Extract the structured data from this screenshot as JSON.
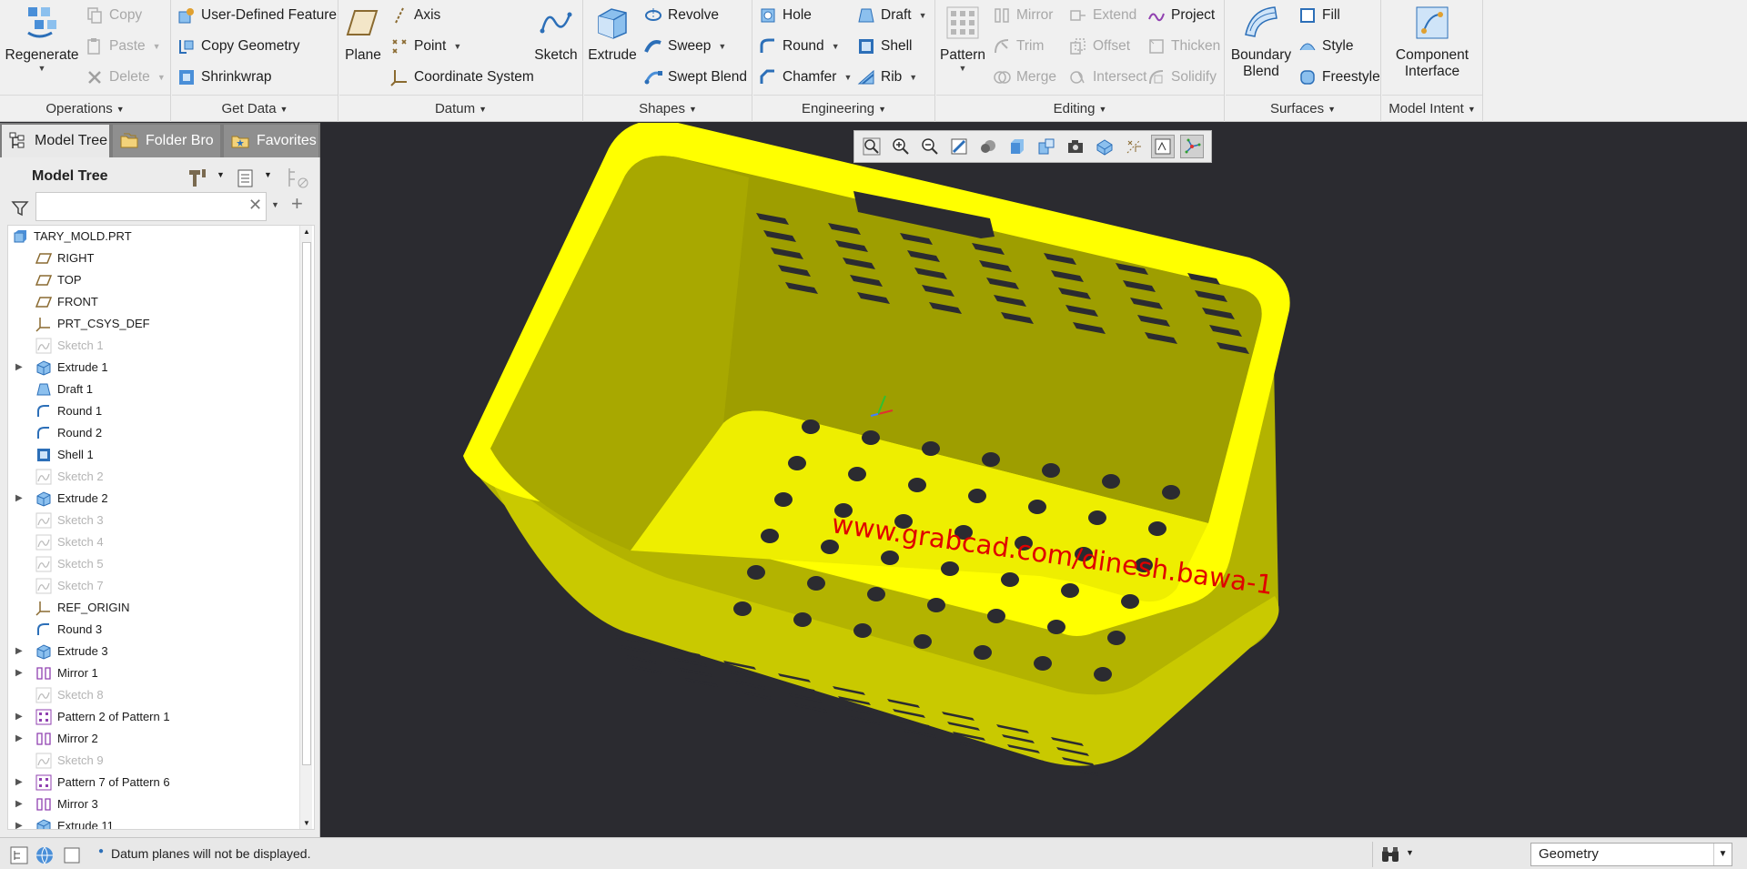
{
  "ribbon": {
    "operations": {
      "regenerate": "Regenerate",
      "copy": "Copy",
      "paste": "Paste",
      "delete": "Delete",
      "label": "Operations"
    },
    "get_data": {
      "user_defined_feature": "User-Defined Feature",
      "copy_geometry": "Copy Geometry",
      "shrinkwrap": "Shrinkwrap",
      "label": "Get Data"
    },
    "datum": {
      "plane": "Plane",
      "axis": "Axis",
      "point": "Point",
      "coordinate_system": "Coordinate System",
      "sketch": "Sketch",
      "label": "Datum"
    },
    "shapes": {
      "extrude": "Extrude",
      "revolve": "Revolve",
      "sweep": "Sweep",
      "swept_blend": "Swept Blend",
      "label": "Shapes"
    },
    "engineering": {
      "hole": "Hole",
      "round": "Round",
      "chamfer": "Chamfer",
      "draft": "Draft",
      "shell": "Shell",
      "rib": "Rib",
      "label": "Engineering"
    },
    "editing": {
      "pattern": "Pattern",
      "mirror": "Mirror",
      "trim": "Trim",
      "merge": "Merge",
      "extend": "Extend",
      "offset": "Offset",
      "intersect": "Intersect",
      "project": "Project",
      "thicken": "Thicken",
      "solidify": "Solidify",
      "label": "Editing"
    },
    "surfaces": {
      "boundary_blend_1": "Boundary",
      "boundary_blend_2": "Blend",
      "fill": "Fill",
      "style": "Style",
      "freestyle": "Freestyle",
      "label": "Surfaces"
    },
    "model_intent": {
      "component_interface_1": "Component",
      "component_interface_2": "Interface",
      "label": "Model Intent"
    }
  },
  "panel": {
    "tabs": [
      "Model Tree",
      "Folder Bro",
      "Favorites"
    ],
    "title": "Model Tree",
    "search_value": "",
    "tree": [
      {
        "label": "TARY_MOLD.PRT",
        "icon": "part-icon",
        "expandable": false,
        "dim": false
      },
      {
        "label": "RIGHT",
        "icon": "datum-plane-icon",
        "expandable": false,
        "dim": false
      },
      {
        "label": "TOP",
        "icon": "datum-plane-icon",
        "expandable": false,
        "dim": false
      },
      {
        "label": "FRONT",
        "icon": "datum-plane-icon",
        "expandable": false,
        "dim": false
      },
      {
        "label": "PRT_CSYS_DEF",
        "icon": "csys-icon",
        "expandable": false,
        "dim": false
      },
      {
        "label": "Sketch 1",
        "icon": "sketch-icon",
        "expandable": false,
        "dim": true
      },
      {
        "label": "Extrude 1",
        "icon": "extrude-icon",
        "expandable": true,
        "dim": false
      },
      {
        "label": "Draft 1",
        "icon": "draft-icon",
        "expandable": false,
        "dim": false
      },
      {
        "label": "Round 1",
        "icon": "round-icon",
        "expandable": false,
        "dim": false
      },
      {
        "label": "Round 2",
        "icon": "round-icon",
        "expandable": false,
        "dim": false
      },
      {
        "label": "Shell 1",
        "icon": "shell-icon",
        "expandable": false,
        "dim": false
      },
      {
        "label": "Sketch 2",
        "icon": "sketch-icon",
        "expandable": false,
        "dim": true
      },
      {
        "label": "Extrude 2",
        "icon": "extrude-icon",
        "expandable": true,
        "dim": false
      },
      {
        "label": "Sketch 3",
        "icon": "sketch-icon",
        "expandable": false,
        "dim": true
      },
      {
        "label": "Sketch 4",
        "icon": "sketch-icon",
        "expandable": false,
        "dim": true
      },
      {
        "label": "Sketch 5",
        "icon": "sketch-icon",
        "expandable": false,
        "dim": true
      },
      {
        "label": "Sketch 7",
        "icon": "sketch-icon",
        "expandable": false,
        "dim": true
      },
      {
        "label": "REF_ORIGIN",
        "icon": "csys-icon",
        "expandable": false,
        "dim": false
      },
      {
        "label": "Round 3",
        "icon": "round-icon",
        "expandable": false,
        "dim": false
      },
      {
        "label": "Extrude 3",
        "icon": "extrude-icon",
        "expandable": true,
        "dim": false
      },
      {
        "label": "Mirror 1",
        "icon": "mirror-icon",
        "expandable": true,
        "dim": false
      },
      {
        "label": "Sketch 8",
        "icon": "sketch-icon",
        "expandable": false,
        "dim": true
      },
      {
        "label": "Pattern 2 of Pattern 1",
        "icon": "pattern-icon",
        "expandable": true,
        "dim": false
      },
      {
        "label": "Mirror 2",
        "icon": "mirror-icon",
        "expandable": true,
        "dim": false
      },
      {
        "label": "Sketch 9",
        "icon": "sketch-icon",
        "expandable": false,
        "dim": true
      },
      {
        "label": "Pattern 7 of Pattern 6",
        "icon": "pattern-icon",
        "expandable": true,
        "dim": false
      },
      {
        "label": "Mirror 3",
        "icon": "mirror-icon",
        "expandable": true,
        "dim": false
      },
      {
        "label": "Extrude 11",
        "icon": "extrude-icon",
        "expandable": true,
        "dim": false
      }
    ]
  },
  "viewport": {
    "watermark": "www.grabcad.com/dinesh.bawa-1",
    "model_color": "#ffff00",
    "background_color": "#2b2b30"
  },
  "status": {
    "message": "Datum planes will not be displayed.",
    "filter_value": "Geometry"
  }
}
